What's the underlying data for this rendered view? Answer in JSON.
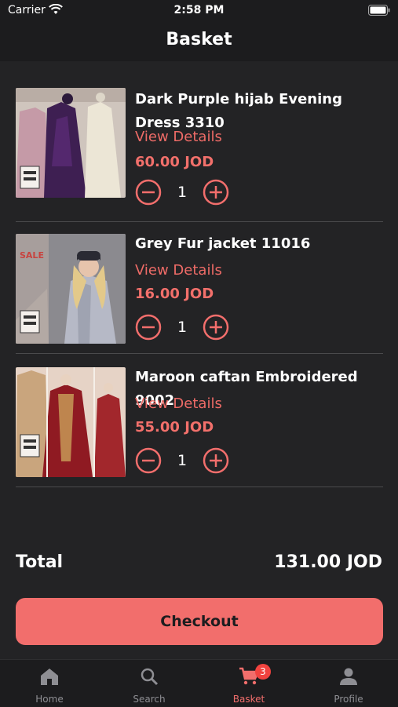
{
  "status_bar": {
    "carrier": "Carrier",
    "time": "2:58 PM"
  },
  "nav": {
    "title": "Basket"
  },
  "items": [
    {
      "title": "Dark Purple hijab Evening Dress 3310",
      "view_details": "View Details",
      "price": "60.00 JOD",
      "quantity": "1"
    },
    {
      "title": "Grey Fur jacket 11016",
      "view_details": "View Details",
      "price": "16.00 JOD",
      "quantity": "1",
      "sale_tag": "SALE"
    },
    {
      "title": "Maroon caftan Embroidered 9002",
      "view_details": "View Details",
      "price": "55.00 JOD",
      "quantity": "1"
    }
  ],
  "summary": {
    "total_label": "Total",
    "total_value": "131.00 JOD"
  },
  "checkout_label": "Checkout",
  "tabs": [
    {
      "label": "Home",
      "icon": "home-icon",
      "active": false
    },
    {
      "label": "Search",
      "icon": "search-icon",
      "active": false
    },
    {
      "label": "Basket",
      "icon": "cart-icon",
      "active": true,
      "badge": "3"
    },
    {
      "label": "Profile",
      "icon": "profile-icon",
      "active": false
    }
  ],
  "colors": {
    "background": "#232325",
    "bar": "#1c1c1e",
    "accent": "#f26e6c",
    "divider": "#4a4a4c",
    "muted": "#8e8e93"
  }
}
